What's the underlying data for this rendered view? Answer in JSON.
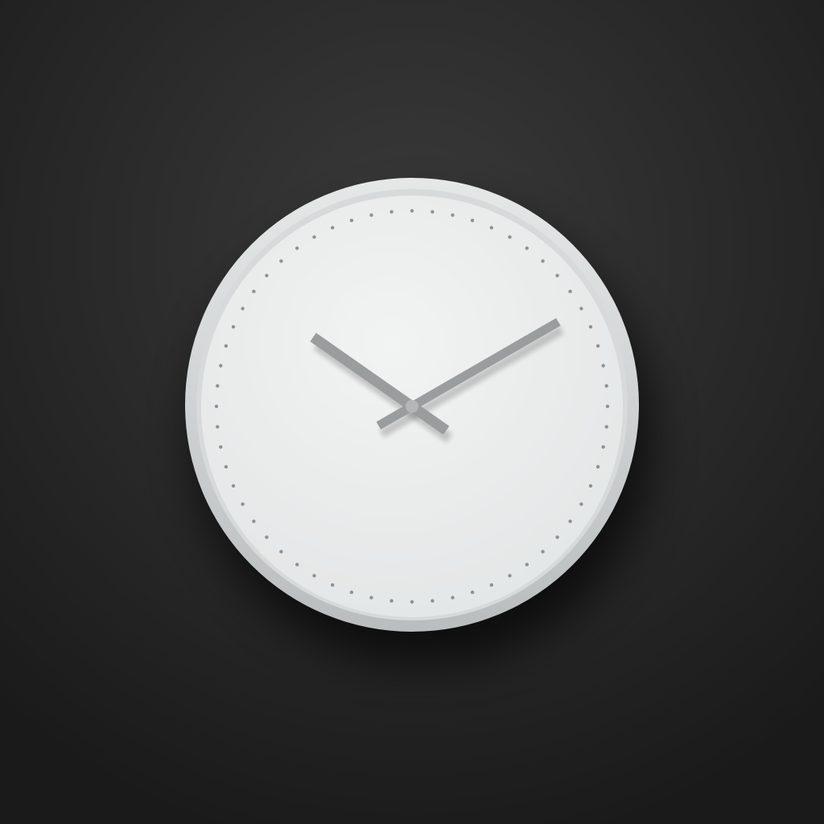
{
  "scene": {
    "subject": "wall-clock",
    "background_color": "#1a1a1a",
    "background_highlight": "#3a3a3a",
    "case_color": "#e6e8e8",
    "case_shadow": "#b9bdbe",
    "face_color": "#e3e6e6",
    "face_highlight": "#f2f3f3",
    "hand_color": "#9a9d9e",
    "tick_color": "#8e9293"
  },
  "clock": {
    "time_hours": 10,
    "time_minutes": 10,
    "tick_count": 60,
    "has_numerals": false,
    "has_second_hand": false
  }
}
